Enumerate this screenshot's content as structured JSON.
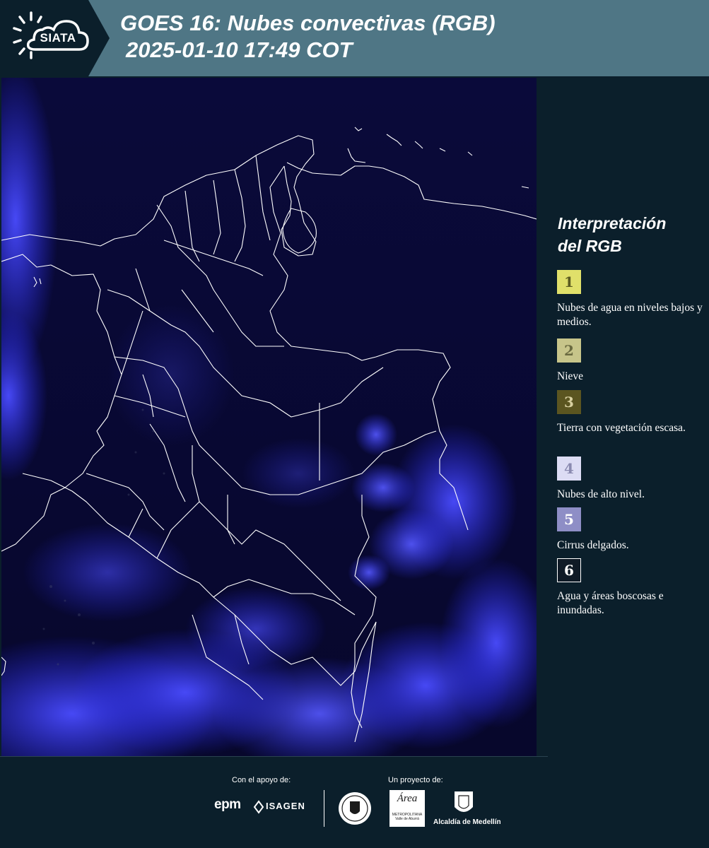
{
  "header": {
    "logo_text": "SIATA",
    "title_line1": "GOES 16: Nubes convectivas (RGB)",
    "title_line2": "2025-01-10 17:49 COT",
    "colors": {
      "bar": "#4f7685",
      "logo_bg": "#0b1f2b"
    }
  },
  "map": {
    "icon": "satellite-rgb-composite",
    "background": "#06062e",
    "cloud_color": "#3a3cff",
    "border_color": "#ffffff"
  },
  "legend": {
    "title_line1": "Interpretación",
    "title_line2": "del RGB",
    "items": [
      {
        "num": "1",
        "label": "Nubes de agua en niveles bajos y medios.",
        "color": "#e0e06a",
        "text_color": "#5a5a20"
      },
      {
        "num": "2",
        "label": "Nieve",
        "color": "#c7c58a",
        "text_color": "#6a6a40"
      },
      {
        "num": "3",
        "label": "Tierra con vegetación escasa.",
        "color": "#5b5520",
        "text_color": "#d8d0a0"
      },
      {
        "num": "4",
        "label": "Nubes de alto nivel.",
        "color": "#dcdcf4",
        "text_color": "#8a8ab0"
      },
      {
        "num": "5",
        "label": "Cirrus delgados.",
        "color": "#8e8ec6",
        "text_color": "#ffffff"
      },
      {
        "num": "6",
        "label": "Agua y áreas boscosas e inundadas.",
        "color": "#0f1a26",
        "text_color": "#ffffff"
      }
    ]
  },
  "footer": {
    "support_label": "Con el apoyo de:",
    "project_label": "Un proyecto de:",
    "sponsors": [
      "epm",
      "ISAGEN"
    ],
    "partners": [
      "Área Metropolitana Valle de Aburrá",
      "Alcaldía de Medellín"
    ],
    "epm_text": "epm",
    "isagen_text": "ISAGEN",
    "area_text": "Área",
    "area_sub": "METROPOLITANA Valle de Aburrá",
    "medellin_text": "Alcaldía de Medellín"
  }
}
